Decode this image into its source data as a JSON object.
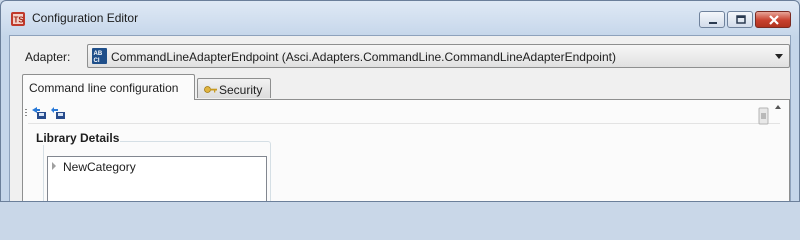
{
  "window": {
    "title": "Configuration Editor",
    "icon": "ts-app-icon",
    "controls": [
      "minimize-icon",
      "maximize-icon",
      "close-icon"
    ]
  },
  "adapter": {
    "label": "Adapter:",
    "selected": "CommandLineAdapterEndpoint (Asci.Adapters.CommandLine.CommandLineAdapterEndpoint)",
    "icon": "adapter-icon"
  },
  "tabs": [
    {
      "label": "Command line configuration",
      "active": true
    },
    {
      "label": "Security",
      "active": false,
      "icon": "key-icon"
    }
  ],
  "toolbar": {
    "items": [
      "import-icon",
      "export-icon"
    ]
  },
  "library": {
    "title": "Library Details",
    "items": [
      {
        "label": "NewCategory",
        "expanded": false
      }
    ]
  },
  "colors": {
    "window_frame": "#c5d6ea",
    "close_button": "#c8412e",
    "panel_bg": "#fbfbfb"
  }
}
